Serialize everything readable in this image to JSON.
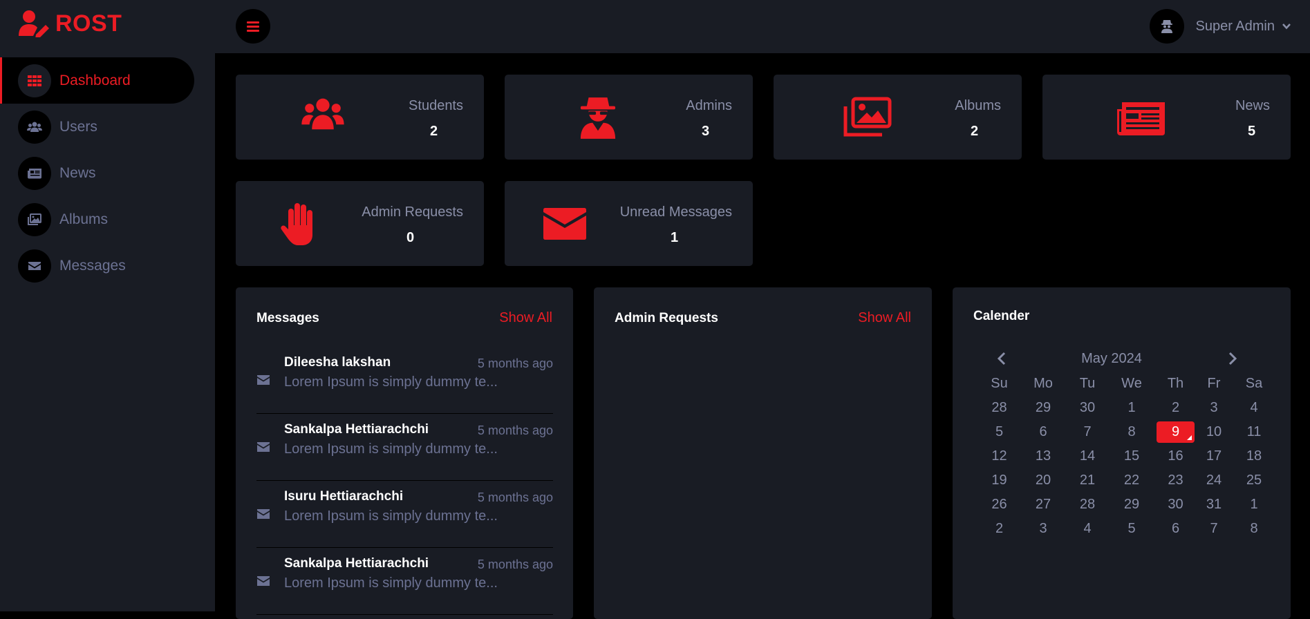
{
  "brand": {
    "name": "ROST",
    "icon": "user-edit-icon"
  },
  "sidebar": {
    "items": [
      {
        "label": "Dashboard",
        "icon": "grid-icon",
        "active": true
      },
      {
        "label": "Users",
        "icon": "users-icon"
      },
      {
        "label": "News",
        "icon": "newspaper-icon"
      },
      {
        "label": "Albums",
        "icon": "images-icon"
      },
      {
        "label": "Messages",
        "icon": "envelope-icon"
      }
    ]
  },
  "topbar": {
    "menu_icon": "hamburger-icon",
    "user_name": "Super Admin",
    "avatar_icon": "user-secret-icon"
  },
  "stats": [
    {
      "label": "Students",
      "value": "2",
      "icon": "users-icon"
    },
    {
      "label": "Admins",
      "value": "3",
      "icon": "user-secret-icon"
    },
    {
      "label": "Albums",
      "value": "2",
      "icon": "images-icon"
    },
    {
      "label": "News",
      "value": "5",
      "icon": "newspaper-icon"
    },
    {
      "label": "Admin Requests",
      "value": "0",
      "icon": "hand-icon"
    },
    {
      "label": "Unread Messages",
      "value": "1",
      "icon": "envelope-icon"
    }
  ],
  "messages_panel": {
    "title": "Messages",
    "show_all": "Show All",
    "items": [
      {
        "name": "Dileesha lakshan",
        "time": "5 months ago",
        "text": "Lorem Ipsum is simply dummy te..."
      },
      {
        "name": "Sankalpa Hettiarachchi",
        "time": "5 months ago",
        "text": "Lorem Ipsum is simply dummy te..."
      },
      {
        "name": "Isuru Hettiarachchi",
        "time": "5 months ago",
        "text": "Lorem Ipsum is simply dummy te..."
      },
      {
        "name": "Sankalpa Hettiarachchi",
        "time": "5 months ago",
        "text": "Lorem Ipsum is simply dummy te..."
      }
    ]
  },
  "requests_panel": {
    "title": "Admin Requests",
    "show_all": "Show All"
  },
  "calendar": {
    "title": "Calender",
    "month": "May 2024",
    "weekdays": [
      "Su",
      "Mo",
      "Tu",
      "We",
      "Th",
      "Fr",
      "Sa"
    ],
    "days": [
      [
        "28",
        "29",
        "30",
        "1",
        "2",
        "3",
        "4"
      ],
      [
        "5",
        "6",
        "7",
        "8",
        "9",
        "10",
        "11"
      ],
      [
        "12",
        "13",
        "14",
        "15",
        "16",
        "17",
        "18"
      ],
      [
        "19",
        "20",
        "21",
        "22",
        "23",
        "24",
        "25"
      ],
      [
        "26",
        "27",
        "28",
        "29",
        "30",
        "31",
        "1"
      ],
      [
        "2",
        "3",
        "4",
        "5",
        "6",
        "7",
        "8"
      ]
    ],
    "selected": "9"
  },
  "colors": {
    "accent": "#ec1c24",
    "panel": "#191c24",
    "background": "#000000",
    "muted": "#6c7293"
  }
}
